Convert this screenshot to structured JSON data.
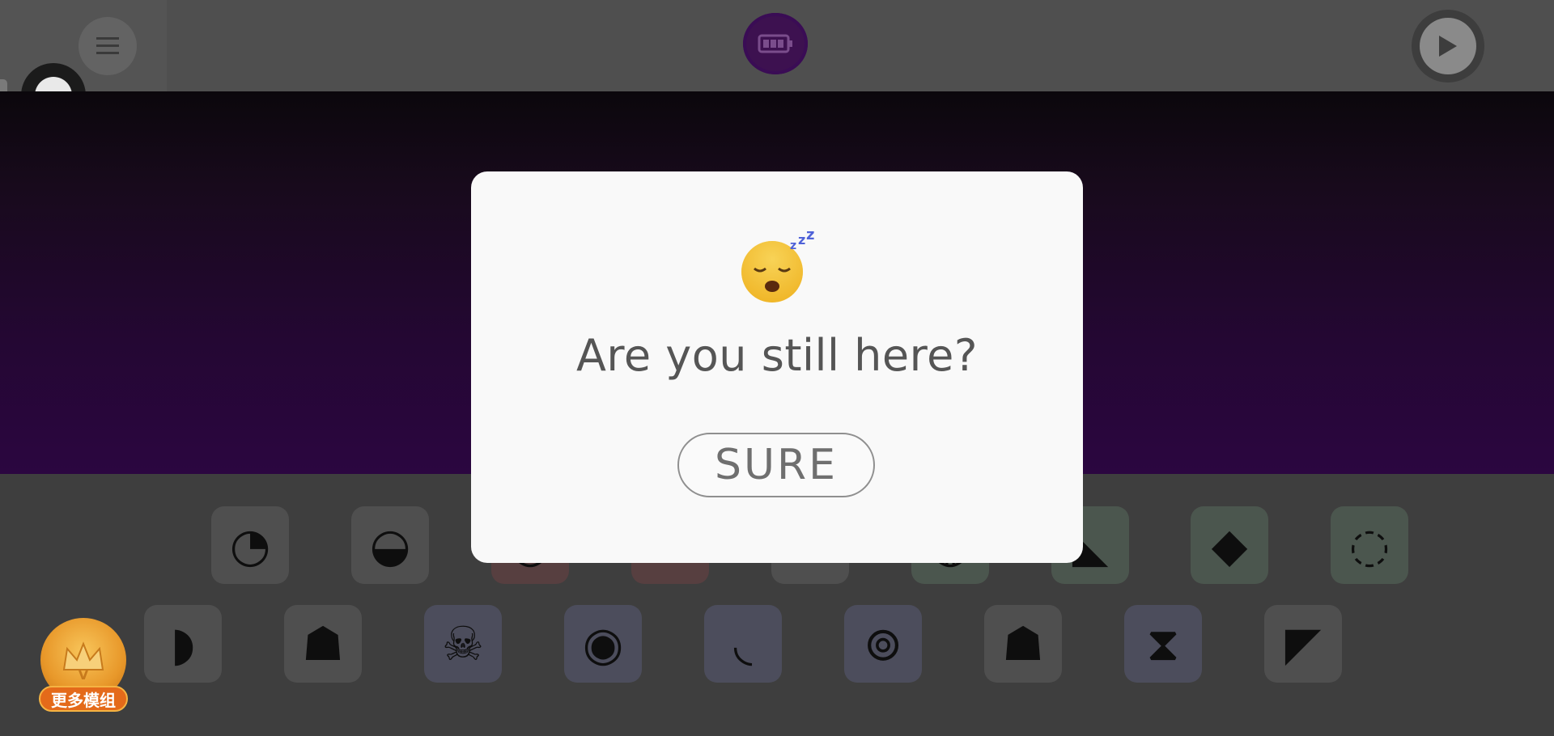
{
  "toolbar": {
    "menu_icon": "hamburger-menu-icon",
    "battery_icon": "battery-icon",
    "play_icon": "play-icon",
    "accent": "#3d1150"
  },
  "sound_tiles": {
    "row1": [
      {
        "icon": "sound-icon-1",
        "glyph": "◔"
      },
      {
        "icon": "sound-icon-2",
        "glyph": "◒"
      },
      {
        "icon": "sound-icon-3",
        "glyph": "◡"
      },
      {
        "icon": "sound-icon-4",
        "glyph": "◠"
      },
      {
        "icon": "sound-icon-5",
        "glyph": "▰"
      },
      {
        "icon": "sound-icon-6",
        "glyph": "◍"
      },
      {
        "icon": "sound-icon-7",
        "glyph": "◣"
      },
      {
        "icon": "sound-icon-8",
        "glyph": "◆"
      },
      {
        "icon": "sound-icon-9",
        "glyph": "◌"
      }
    ],
    "row2": [
      {
        "icon": "sound-icon-10",
        "glyph": "◗"
      },
      {
        "icon": "sound-icon-11",
        "glyph": "☗"
      },
      {
        "icon": "sound-icon-12",
        "glyph": "☠"
      },
      {
        "icon": "sound-icon-13",
        "glyph": "◉"
      },
      {
        "icon": "sound-icon-14",
        "glyph": "◟"
      },
      {
        "icon": "sound-icon-15",
        "glyph": "⊚"
      },
      {
        "icon": "sound-icon-16",
        "glyph": "☗"
      },
      {
        "icon": "sound-icon-17",
        "glyph": "⧗"
      },
      {
        "icon": "sound-icon-18",
        "glyph": "◤"
      }
    ]
  },
  "vip_badge": {
    "label": "更多模组",
    "icon": "crown-icon",
    "crown_letter": "V"
  },
  "dialog": {
    "emoji_icon": "sleeping-face-icon",
    "title": "Are you still here?",
    "confirm_label": "SURE"
  }
}
